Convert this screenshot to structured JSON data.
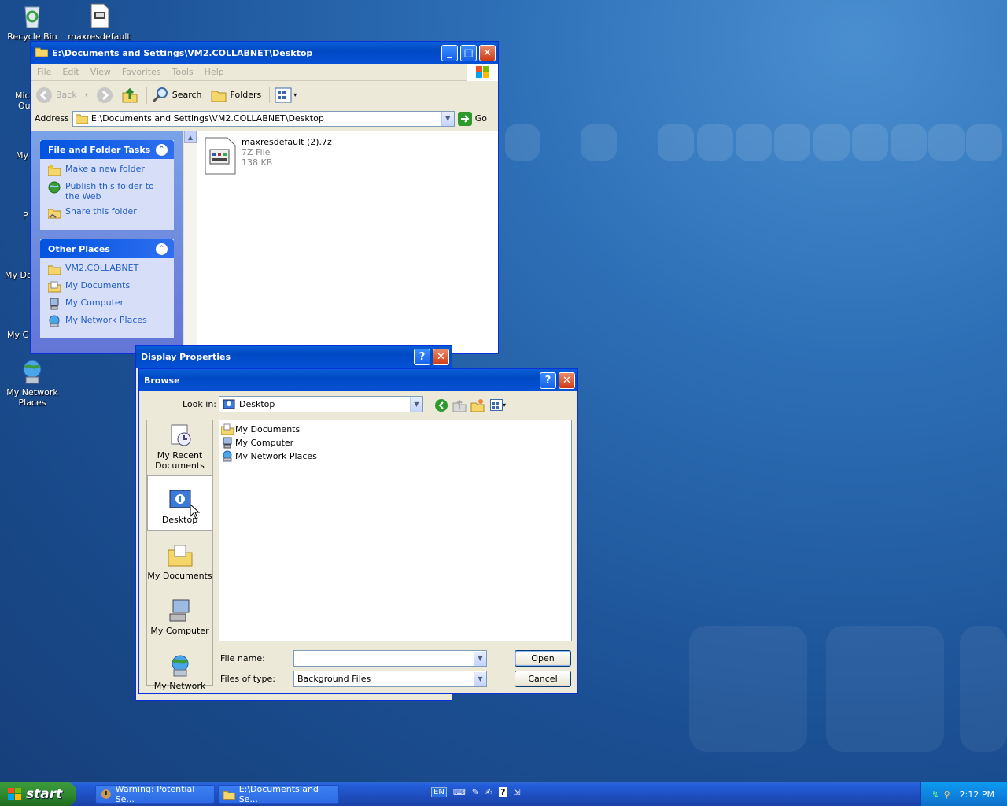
{
  "desktop": {
    "icons": [
      {
        "label": "Recycle Bin"
      },
      {
        "label": "maxresdefault"
      },
      {
        "label": "My Network Places"
      }
    ],
    "edge_labels": [
      "Mic",
      "Ou",
      "My",
      "P",
      "My Dc",
      "My C"
    ]
  },
  "explorer": {
    "title": "E:\\Documents and Settings\\VM2.COLLABNET\\Desktop",
    "menu": [
      "File",
      "Edit",
      "View",
      "Favorites",
      "Tools",
      "Help"
    ],
    "toolbar": {
      "back": "Back",
      "search": "Search",
      "folders": "Folders"
    },
    "address_label": "Address",
    "address_value": "E:\\Documents and Settings\\VM2.COLLABNET\\Desktop",
    "go_label": "Go",
    "tasks": {
      "title": "File and Folder Tasks",
      "items": [
        "Make a new folder",
        "Publish this folder to the Web",
        "Share this folder"
      ]
    },
    "other_places": {
      "title": "Other Places",
      "items": [
        "VM2.COLLABNET",
        "My Documents",
        "My Computer",
        "My Network Places"
      ]
    },
    "file": {
      "name": "maxresdefault (2).7z",
      "type": "7Z File",
      "size": "138 KB"
    }
  },
  "display_properties": {
    "title": "Display Properties"
  },
  "browse": {
    "title": "Browse",
    "look_in_label": "Look in:",
    "look_in_value": "Desktop",
    "places": [
      "My Recent Documents",
      "Desktop",
      "My Documents",
      "My Computer",
      "My Network"
    ],
    "files": [
      "My Documents",
      "My Computer",
      "My Network Places"
    ],
    "file_name_label": "File name:",
    "file_name_value": "",
    "files_of_type_label": "Files of type:",
    "files_of_type_value": "Background Files",
    "open_label": "Open",
    "cancel_label": "Cancel"
  },
  "taskbar": {
    "start_label": "start",
    "items": [
      "Warning: Potential Se...",
      "E:\\Documents and Se..."
    ],
    "lang": "EN",
    "clock": "2:12 PM"
  },
  "colors": {
    "title_blue": "#0a5fd8",
    "taskpane_link": "#215dc6",
    "start_green": "#2f8a2f"
  }
}
